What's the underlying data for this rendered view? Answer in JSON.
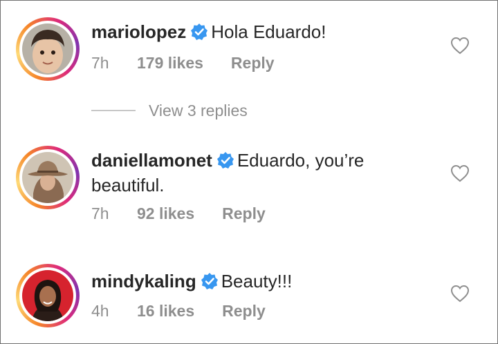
{
  "comments": [
    {
      "username": "mariolopez",
      "verified": true,
      "text": "Hola Eduardo!",
      "time": "7h",
      "likes": "179 likes",
      "reply": "Reply"
    },
    {
      "username": "daniellamonet",
      "verified": true,
      "text": "Eduardo, you’re beautiful.",
      "time": "7h",
      "likes": "92 likes",
      "reply": "Reply"
    },
    {
      "username": "mindykaling",
      "verified": true,
      "text": "Beauty!!!",
      "time": "4h",
      "likes": "16 likes",
      "reply": "Reply"
    }
  ],
  "view_replies": "View 3 replies",
  "icons": {
    "verified": "verified-badge-icon",
    "like": "heart-outline-icon"
  },
  "colors": {
    "verified_blue": "#3897f0",
    "secondary_text": "#8e8e8e",
    "primary_text": "#262626"
  }
}
